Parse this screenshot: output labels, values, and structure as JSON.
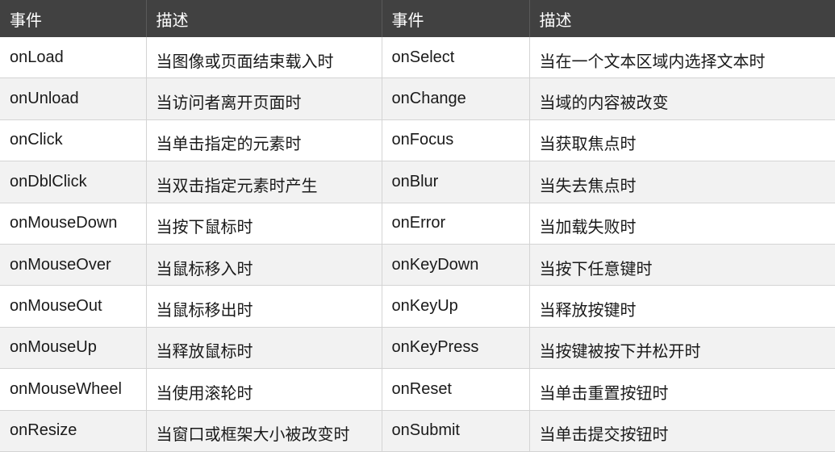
{
  "header": {
    "col_event_1": "事件",
    "col_desc_1": "描述",
    "col_event_2": "事件",
    "col_desc_2": "描述"
  },
  "rows": [
    {
      "event1": "onLoad",
      "desc1": "当图像或页面结束载入时",
      "event2": "onSelect",
      "desc2": "当在一个文本区域内选择文本时"
    },
    {
      "event1": "onUnload",
      "desc1": "当访问者离开页面时",
      "event2": "onChange",
      "desc2": "当域的内容被改变"
    },
    {
      "event1": "onClick",
      "desc1": "当单击指定的元素时",
      "event2": "onFocus",
      "desc2": "当获取焦点时"
    },
    {
      "event1": "onDblClick",
      "desc1": "当双击指定元素时产生",
      "event2": "onBlur",
      "desc2": "当失去焦点时"
    },
    {
      "event1": "onMouseDown",
      "desc1": "当按下鼠标时",
      "event2": "onError",
      "desc2": "当加载失败时"
    },
    {
      "event1": "onMouseOver",
      "desc1": "当鼠标移入时",
      "event2": "onKeyDown",
      "desc2": "当按下任意键时"
    },
    {
      "event1": "onMouseOut",
      "desc1": "当鼠标移出时",
      "event2": "onKeyUp",
      "desc2": "当释放按键时"
    },
    {
      "event1": "onMouseUp",
      "desc1": "当释放鼠标时",
      "event2": "onKeyPress",
      "desc2": "当按键被按下并松开时"
    },
    {
      "event1": "onMouseWheel",
      "desc1": "当使用滚轮时",
      "event2": "onReset",
      "desc2": "当单击重置按钮时"
    },
    {
      "event1": "onResize",
      "desc1": "当窗口或框架大小被改变时",
      "event2": "onSubmit",
      "desc2": "当单击提交按钮时"
    }
  ]
}
